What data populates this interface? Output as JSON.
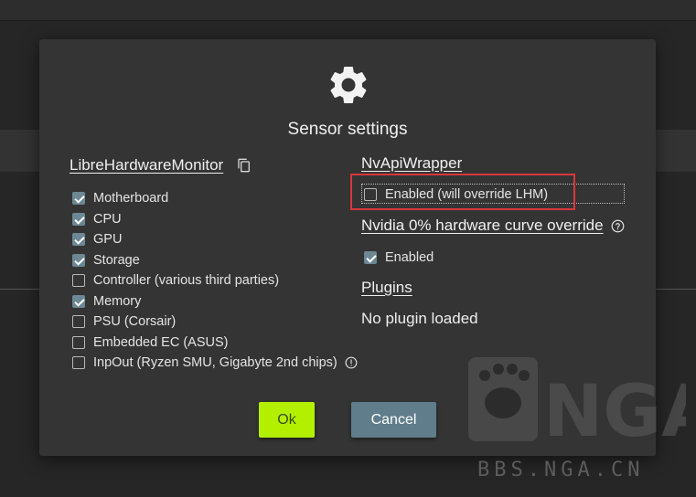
{
  "dialog": {
    "title": "Sensor settings",
    "icon": "gear-icon"
  },
  "lhm": {
    "title": "LibreHardwareMonitor",
    "items": [
      {
        "label": "Motherboard",
        "checked": true
      },
      {
        "label": "CPU",
        "checked": true
      },
      {
        "label": "GPU",
        "checked": true
      },
      {
        "label": "Storage",
        "checked": true
      },
      {
        "label": "Controller (various third parties)",
        "checked": false
      },
      {
        "label": "Memory",
        "checked": true
      },
      {
        "label": "PSU (Corsair)",
        "checked": false
      },
      {
        "label": "Embedded EC (ASUS)",
        "checked": false
      },
      {
        "label": "InpOut (Ryzen SMU, Gigabyte 2nd chips)",
        "checked": false
      }
    ]
  },
  "nvapi": {
    "title": "NvApiWrapper",
    "enabled_label": "Enabled (will override LHM)",
    "enabled": false
  },
  "nvidia_curve": {
    "title": "Nvidia 0% hardware curve override",
    "enabled_label": "Enabled",
    "enabled": true
  },
  "plugins": {
    "title": "Plugins",
    "status": "No plugin loaded"
  },
  "buttons": {
    "ok": "Ok",
    "cancel": "Cancel"
  },
  "watermark": {
    "logo": "NGA",
    "url": "BBS.NGA.CN"
  },
  "colors": {
    "ok_button": "#b2f000",
    "cancel_button": "#607d8b",
    "checkbox_checked": "#6d8794",
    "highlight": "#d9363e"
  }
}
